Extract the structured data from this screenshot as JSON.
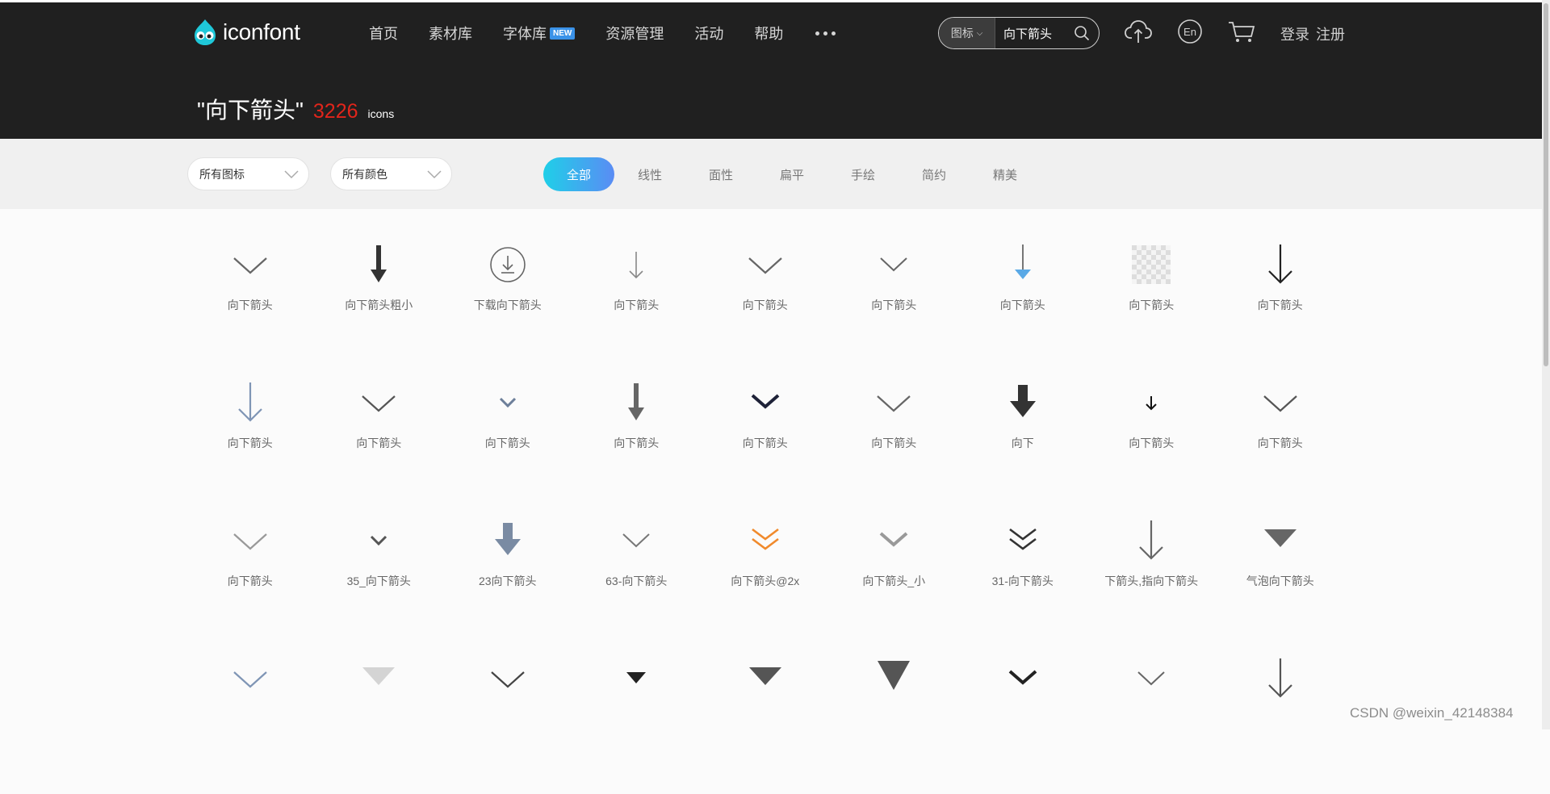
{
  "header": {
    "logo_text": "iconfont",
    "nav": [
      {
        "label": "首页"
      },
      {
        "label": "素材库"
      },
      {
        "label": "字体库",
        "badge": "NEW"
      },
      {
        "label": "资源管理"
      },
      {
        "label": "活动"
      },
      {
        "label": "帮助"
      }
    ],
    "search": {
      "type_label": "图标",
      "query": "向下箭头"
    },
    "icons": {
      "upload": "cloud-upload-icon",
      "language": "En",
      "cart": "cart-icon"
    },
    "login": "登录",
    "register": "注册"
  },
  "result": {
    "query": "\"向下箭头\"",
    "count": "3226",
    "unit": "icons"
  },
  "filters": {
    "dropdowns": [
      "所有图标",
      "所有颜色"
    ],
    "tabs": [
      "全部",
      "线性",
      "面性",
      "扁平",
      "手绘",
      "简约",
      "精美"
    ],
    "active_tab": "全部"
  },
  "icons": [
    {
      "label": "向下箭头",
      "glyph": "chevron-down-icon",
      "color": "#666666"
    },
    {
      "label": "向下箭头粗小",
      "glyph": "arrow-down-bold-icon",
      "color": "#333333"
    },
    {
      "label": "下载向下箭头",
      "glyph": "download-circle-icon",
      "color": "#666666"
    },
    {
      "label": "向下箭头",
      "glyph": "arrow-down-thin-icon",
      "color": "#888888"
    },
    {
      "label": "向下箭头",
      "glyph": "chevron-down-icon",
      "color": "#666666"
    },
    {
      "label": "向下箭头",
      "glyph": "chevron-down-small-icon",
      "color": "#666666"
    },
    {
      "label": "向下箭头",
      "glyph": "arrow-down-blue-tip-icon",
      "color": "#5aa9e6"
    },
    {
      "label": "向下箭头",
      "glyph": "checker-placeholder-icon",
      "color": "#dddddd"
    },
    {
      "label": "向下箭头",
      "glyph": "arrow-down-line-icon",
      "color": "#222222"
    },
    {
      "label": "向下箭头",
      "glyph": "arrow-down-line-icon",
      "color": "#7f95b5"
    },
    {
      "label": "向下箭头",
      "glyph": "chevron-down-icon",
      "color": "#555555"
    },
    {
      "label": "向下箭头",
      "glyph": "chevron-down-tiny-icon",
      "color": "#6d7f9a"
    },
    {
      "label": "向下箭头",
      "glyph": "arrow-down-bold-icon",
      "color": "#666666"
    },
    {
      "label": "向下箭头",
      "glyph": "chevron-down-thick-icon",
      "color": "#1e2238"
    },
    {
      "label": "向下箭头",
      "glyph": "chevron-down-icon",
      "color": "#666666"
    },
    {
      "label": "向下",
      "glyph": "arrow-down-fat-icon",
      "color": "#333333"
    },
    {
      "label": "向下箭头",
      "glyph": "arrow-down-mini-icon",
      "color": "#111111"
    },
    {
      "label": "向下箭头",
      "glyph": "chevron-down-icon",
      "color": "#555555"
    },
    {
      "label": "向下箭头",
      "glyph": "chevron-down-icon",
      "color": "#999999"
    },
    {
      "label": "35_向下箭头",
      "glyph": "chevron-down-tiny-icon",
      "color": "#555555"
    },
    {
      "label": "23向下箭头",
      "glyph": "arrow-down-fat-icon",
      "color": "#7a8ba3"
    },
    {
      "label": "63-向下箭头",
      "glyph": "chevron-down-small-icon",
      "color": "#777777"
    },
    {
      "label": "向下箭头@2x",
      "glyph": "double-chevron-down-icon",
      "color": "#f08a2c"
    },
    {
      "label": "向下箭头_小",
      "glyph": "chevron-down-thick-icon",
      "color": "#999999"
    },
    {
      "label": "31-向下箭头",
      "glyph": "double-chevron-down-icon",
      "color": "#333333"
    },
    {
      "label": "下箭头,指向下箭头",
      "glyph": "arrow-down-line-icon",
      "color": "#666666"
    },
    {
      "label": "气泡向下箭头",
      "glyph": "triangle-down-icon",
      "color": "#666666"
    },
    {
      "label": "",
      "glyph": "chevron-down-icon",
      "color": "#7f95b5"
    },
    {
      "label": "",
      "glyph": "triangle-down-icon",
      "color": "#d4d4d4"
    },
    {
      "label": "",
      "glyph": "chevron-down-icon",
      "color": "#444444"
    },
    {
      "label": "",
      "glyph": "triangle-down-small-icon",
      "color": "#222222"
    },
    {
      "label": "",
      "glyph": "triangle-down-icon",
      "color": "#555555"
    },
    {
      "label": "",
      "glyph": "triangle-down-big-icon",
      "color": "#555555"
    },
    {
      "label": "",
      "glyph": "chevron-down-thick-icon",
      "color": "#222222"
    },
    {
      "label": "",
      "glyph": "chevron-down-small-icon",
      "color": "#666666"
    },
    {
      "label": "",
      "glyph": "arrow-down-line-icon",
      "color": "#555555"
    }
  ],
  "watermark": "CSDN @weixin_42148384",
  "colors": {
    "topbar": "#202020",
    "accent_red": "#e1251b",
    "tab_gradient_start": "#1fcfe8",
    "tab_gradient_end": "#5a8cf4"
  }
}
